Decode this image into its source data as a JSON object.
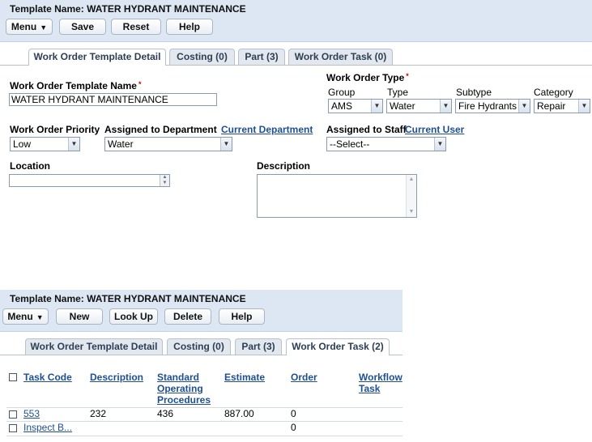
{
  "panel1": {
    "title": "Template Name: WATER HYDRANT MAINTENANCE",
    "toolbar": {
      "menu": "Menu",
      "save": "Save",
      "reset": "Reset",
      "help": "Help"
    },
    "tabs": [
      "Work Order Template Detail",
      "Costing (0)",
      "Part (3)",
      "Work Order Task (0)"
    ],
    "active_tab": "Work Order Template Detail",
    "form": {
      "template_name_label": "Work Order Template Name",
      "template_name_value": "WATER HYDRANT MAINTENANCE",
      "wo_type_label": "Work Order Type",
      "group_label": "Group",
      "group_value": "AMS",
      "type_label": "Type",
      "type_value": "Water",
      "subtype_label": "Subtype",
      "subtype_value": "Fire Hydrants",
      "category_label": "Category",
      "category_value": "Repair",
      "priority_label": "Work Order Priority",
      "priority_value": "Low",
      "dept_label": "Assigned to Department",
      "dept_link": "Current Department",
      "dept_value": "Water",
      "staff_label": "Assigned to Staff",
      "staff_link": "Current User",
      "staff_value": "--Select--",
      "location_label": "Location",
      "location_value": "",
      "description_label": "Description",
      "description_value": ""
    }
  },
  "panel2": {
    "title": "Template Name: WATER HYDRANT MAINTENANCE",
    "toolbar": {
      "menu": "Menu",
      "new": "New",
      "lookup": "Look Up",
      "delete": "Delete",
      "help": "Help"
    },
    "tabs": [
      "Work Order Template Detail",
      "Costing (0)",
      "Part (3)",
      "Work Order Task (2)"
    ],
    "active_tab": "Work Order Task (2)",
    "table": {
      "columns": [
        "Task Code",
        "Description",
        "Standard Operating Procedures",
        "Estimate",
        "Order",
        "Workflow Task"
      ],
      "rows": [
        {
          "task_code": "553",
          "description": "232",
          "sop": "436",
          "estimate": "887.00",
          "order": "0",
          "workflow": ""
        },
        {
          "task_code": "Inspect B...",
          "description": "",
          "sop": "",
          "estimate": "",
          "order": "0",
          "workflow": ""
        }
      ]
    }
  },
  "colors": {
    "header_bg": "#dde7f3",
    "link": "#1f4f8f",
    "required": "#cc0000"
  }
}
